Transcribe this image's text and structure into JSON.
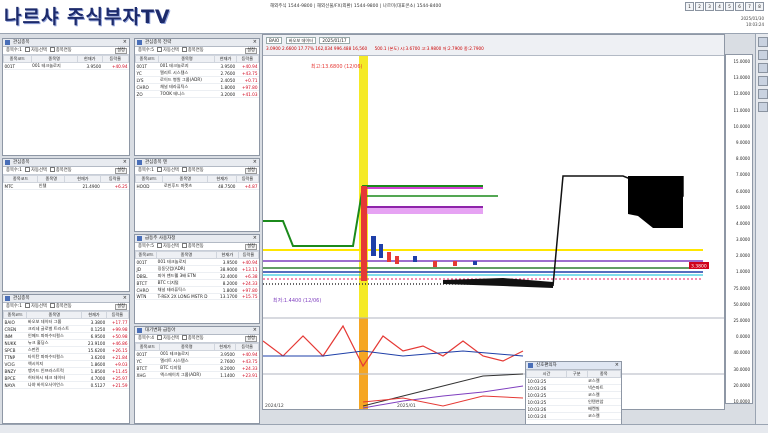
{
  "brand": "나르샤 주식부자TV",
  "hotlines": "해외주식 1544-9800 | 해외선물/FX(외환) 1544-9800 | 나르미(대표콘소) 1544-8400",
  "clock": {
    "date": "2025/01/30",
    "time": "10:03:24"
  },
  "window_buttons": [
    "1",
    "2",
    "3",
    "4",
    "5",
    "6",
    "7",
    "8"
  ],
  "panels": {
    "p1": {
      "title": "관심종목",
      "tool": "종목수:1",
      "auto": "자동선택",
      "sel": "종목연동",
      "setting": "설정",
      "headers": [
        "종목코드",
        "종목명",
        "현재가",
        "등락율"
      ],
      "rows": [
        [
          "001T",
          "001 테크놀로지",
          "3.9500",
          "+40.94"
        ]
      ]
    },
    "p2": {
      "title": "관심종목 전략",
      "tool": "종목수:5",
      "auto": "자동선택",
      "sel": "종목연동",
      "setting": "설정",
      "headers": [
        "종목코드",
        "종목명",
        "현재가",
        "등락율"
      ],
      "rows": [
        [
          "001T",
          "001 테크놀로지",
          "3.9500",
          "+40.94"
        ],
        [
          "YC",
          "엘리트 시스템스",
          "2.7600",
          "+43.75"
        ],
        [
          "LYS",
          "로이드 병원 그룹(ADR)",
          "2.4050",
          "+0.71"
        ],
        [
          "CHRO",
          "채널 테라퓨틱스",
          "1.8000",
          "+97.80"
        ],
        [
          "ZO",
          "7OOK 테니스",
          "3.2000",
          "+41.03"
        ]
      ]
    },
    "p3": {
      "title": "관심종목",
      "tool": "종목수:1",
      "auto": "자동선택",
      "sel": "종목연동",
      "setting": "설정",
      "headers": [
        "종목코드",
        "종목명",
        "현재가",
        "등락율"
      ],
      "rows": [
        [
          "MTC",
          "인텔",
          "21.4900",
          "+6.25"
        ]
      ]
    },
    "p4": {
      "title": "관심종목 텐",
      "tool": "종목수:1",
      "auto": "자동선택",
      "sel": "종목연동",
      "setting": "설정",
      "headers": [
        "종목코드",
        "종목명",
        "현재가",
        "등락율"
      ],
      "rows": [
        [
          "HOOD",
          "로빈후드 마켓츠",
          "48.7500",
          "+4.87"
        ]
      ]
    },
    "p5": {
      "title": "급등주 사용자정",
      "tool": "종목수:5",
      "auto": "자동선택",
      "sel": "종목연동",
      "setting": "설정",
      "headers": [
        "종목코드",
        "종목명",
        "현재가",
        "등락율"
      ],
      "rows": [
        [
          "001T",
          "001 테크놀로지",
          "3.9500",
          "+40.94"
        ],
        [
          "JD",
          "징동닷컴(ADR)",
          "38.9000",
          "+13.11"
        ],
        [
          "DBSL",
          "피어 밴드웰 3배 ETN",
          "32.4000",
          "+6.38"
        ],
        [
          "BTCT",
          "BTC 디지털",
          "8.2000",
          "+24.33"
        ],
        [
          "CHRO",
          "채널 테라퓨틱스",
          "1.8000",
          "+97.80"
        ],
        [
          "WTN",
          "T-REX 2X LONG MSTR D",
          "13.1700",
          "+15.75"
        ]
      ]
    },
    "p6": {
      "title": "관심종목",
      "tool": "종목수:1",
      "auto": "자동선택",
      "sel": "종목연동",
      "setting": "설정",
      "headers": [
        "종목코드",
        "종목명",
        "현재가",
        "등락율"
      ],
      "rows": [
        [
          "BAIO",
          "바오보 데이터 그룹",
          "3.3800",
          "+17.77"
        ],
        [
          "CREN",
          "크리네 글로벌 트라스트",
          "0.1250",
          "+99.98"
        ],
        [
          "INM",
          "인메드 파마수티컬스",
          "6.9500",
          "+50.98"
        ],
        [
          "NUKK",
          "뉴크 홀딩스",
          "23.9100",
          "+46.86"
        ],
        [
          "SPCB",
          "스펀린",
          "15.6200",
          "+26.15"
        ],
        [
          "TTNP",
          "타이탄 파마수티컬스",
          "3.6200",
          "+21.84"
        ],
        [
          "VCIG",
          "엑시이지",
          "1.8600",
          "+9.03"
        ],
        [
          "BNZY",
          "뱅가드 인프라스트럭",
          "1.8500",
          "+11.45"
        ],
        [
          "BPCE",
          "허터하시 테크 데이터",
          "4.7000",
          "+25.97"
        ],
        [
          "NAYA",
          "나야 바이오사이언스",
          "0.5127",
          "+21.59"
        ]
      ]
    },
    "p7": {
      "title": "대기변화 급등아",
      "tool": "종목수:4",
      "auto": "자동선택",
      "sel": "종목연동",
      "setting": "설정",
      "headers": [
        "종목코드",
        "종목명",
        "현재가",
        "등락율"
      ],
      "rows": [
        [
          "001T",
          "001 테크놀로지",
          "3.9500",
          "+40.94"
        ],
        [
          "YC",
          "엘리트 시스템스",
          "2.7600",
          "+43.75"
        ],
        [
          "BTCT",
          "BTC 디지털",
          "8.2000",
          "+24.33"
        ],
        [
          "XHG",
          "엑스에이치 그룹(ADR)",
          "1.1400",
          "+23.91"
        ]
      ]
    }
  },
  "chart": {
    "symbol": "BAIO",
    "name": "바오보 데이터",
    "date": "2025/01/17",
    "values_row": "3.0900  2.6600  17.77%  162,034  996.488  16,560",
    "ohlc_row": "500.1 (본도)  시:3.6700  고:3.9800  저:2.7900  종:2.7900",
    "annot_high": "최고:13.6800 (12/06)",
    "annot_low": "최저:1.4400 (12/06)",
    "x_labels": [
      "2024/12",
      "2025/01"
    ],
    "price_label": "3.3800"
  },
  "axis_ticks": [
    "15.0000",
    "13.0000",
    "12.0000",
    "11.0000",
    "10.0000",
    "9.0000",
    "8.0000",
    "7.0000",
    "6.0000",
    "5.0000",
    "4.0000",
    "3.0000",
    "2.0000",
    "1.0000",
    "75.0000",
    "50.0000",
    "25.0000",
    "0.0000",
    "40.0000",
    "30.0000",
    "20.0000",
    "10.0000"
  ],
  "popup": {
    "title": "신호편의자",
    "headers": [
      "시간",
      "구분",
      "종목"
    ],
    "rows": [
      [
        "10:03:25",
        "",
        "코스켈"
      ],
      [
        "10:03:26",
        "",
        "넥슨파트"
      ],
      [
        "10:03:25",
        "",
        "코스켈"
      ],
      [
        "10:03:25",
        "",
        "인텐연암"
      ],
      [
        "10:03:26",
        "",
        "배켄빌"
      ],
      [
        "10:03:24",
        "",
        "코스켈"
      ]
    ]
  },
  "colors": {
    "accent": "#1c2a6b",
    "up": "#d0021b",
    "volume_bar": "#f5a623",
    "highlight": "#f3e600"
  }
}
